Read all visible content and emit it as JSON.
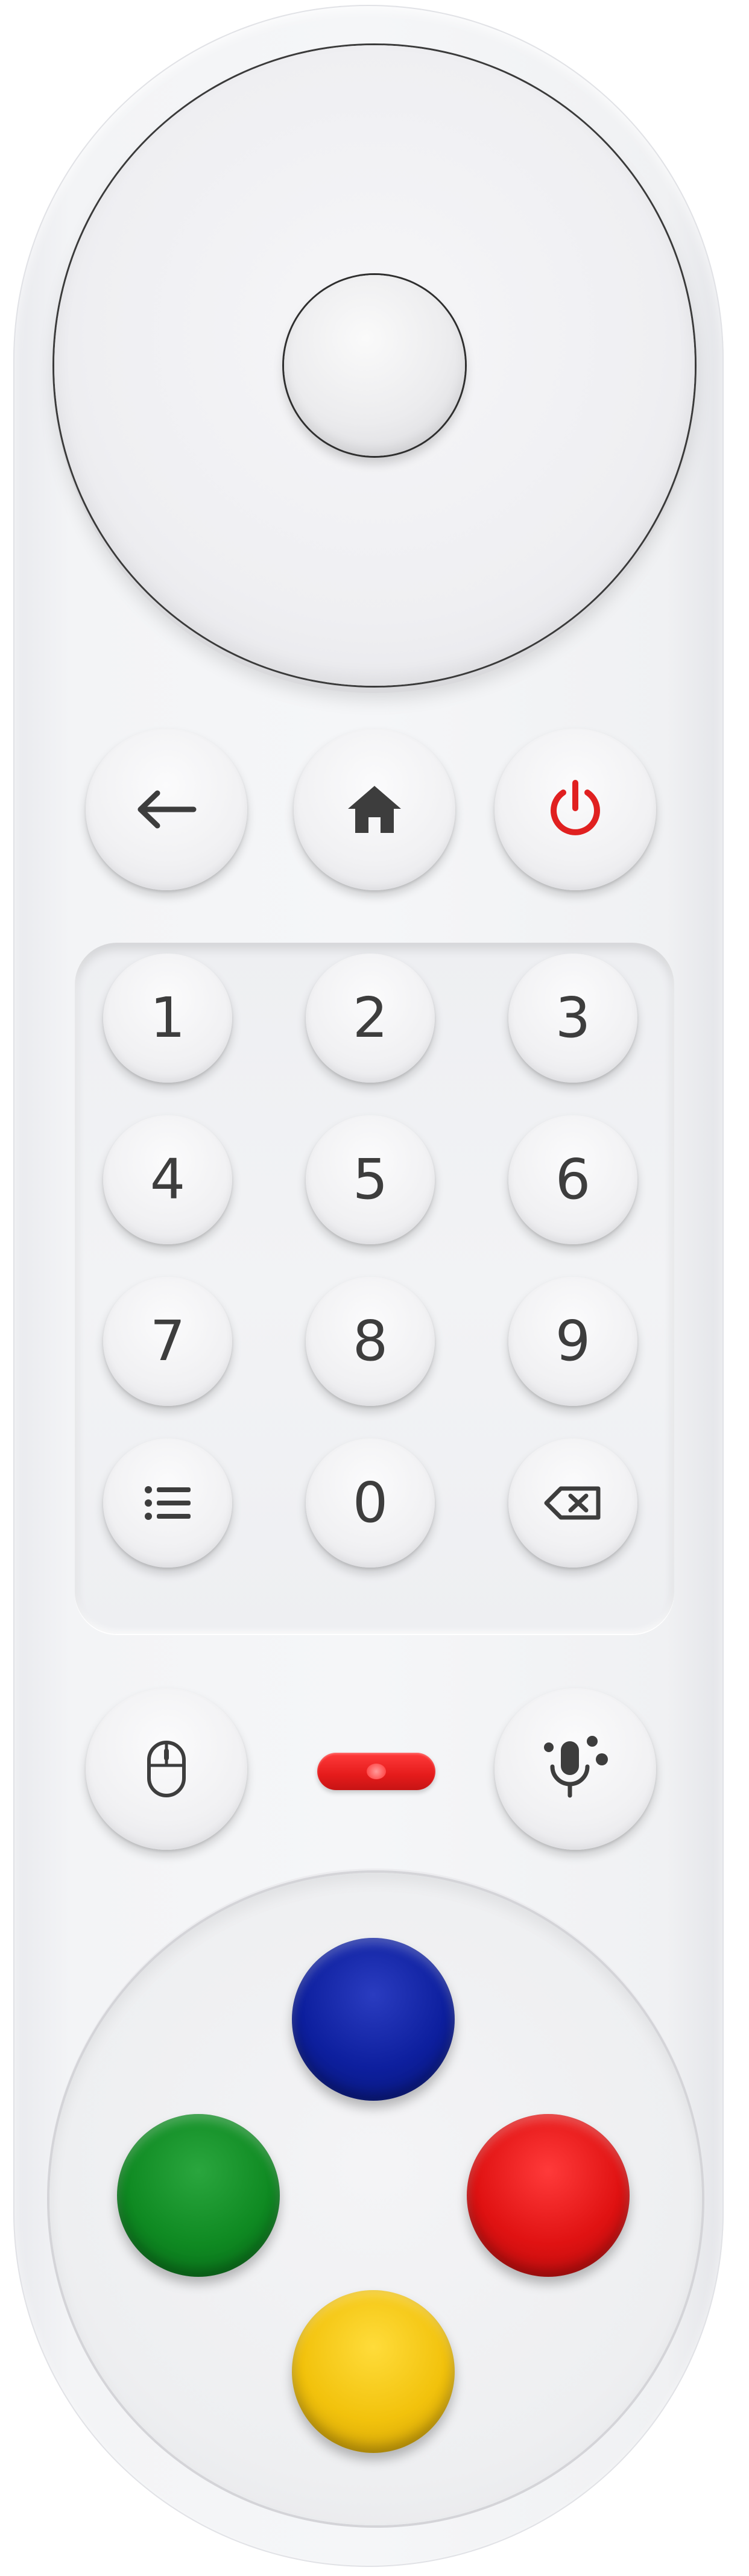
{
  "remote": {
    "body_color": "#f3f4f6",
    "dpad": {
      "ok_label": ""
    },
    "nav_row": [
      {
        "name": "back",
        "icon": "arrow-left-icon"
      },
      {
        "name": "home",
        "icon": "home-icon"
      },
      {
        "name": "power",
        "icon": "power-icon",
        "color": "#e02020"
      }
    ],
    "keypad": {
      "digits": [
        "1",
        "2",
        "3",
        "4",
        "5",
        "6",
        "7",
        "8",
        "9",
        "0"
      ],
      "menu_icon": "list-icon",
      "delete_icon": "backspace-icon"
    },
    "bottom_row": {
      "mouse_icon": "mouse-icon",
      "mic_icon": "voice-assistant-icon",
      "indicator_color": "#e51b1b"
    },
    "color_buttons": [
      {
        "name": "blue",
        "color": "#0d1f9e"
      },
      {
        "name": "green",
        "color": "#0f8a22"
      },
      {
        "name": "red",
        "color": "#e01212"
      },
      {
        "name": "yellow",
        "color": "#f2c20c"
      }
    ]
  }
}
